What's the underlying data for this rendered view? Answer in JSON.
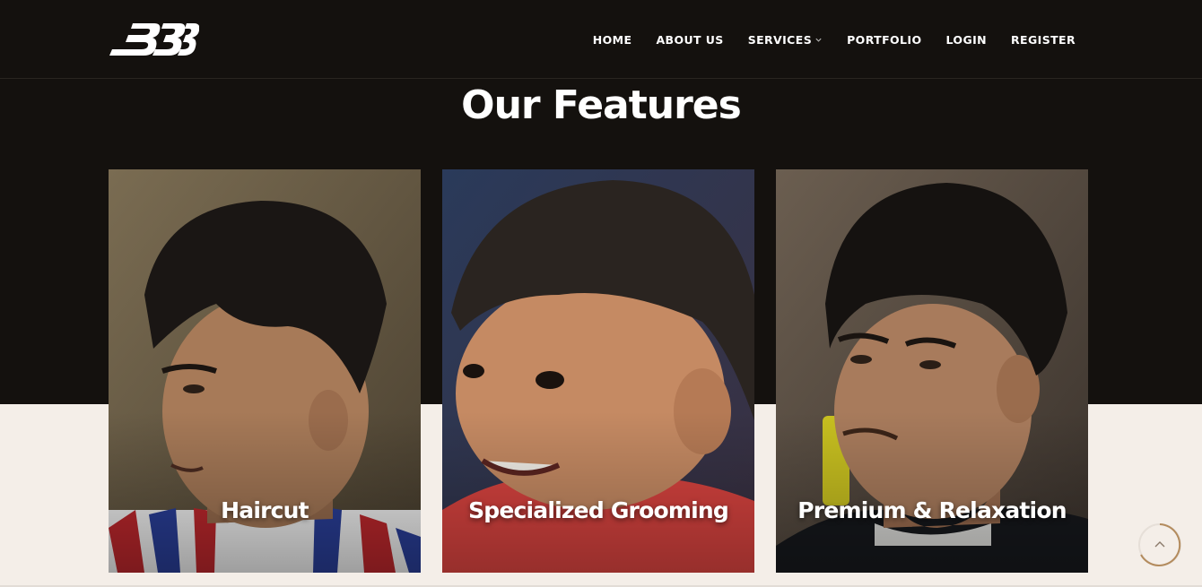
{
  "header": {
    "logo_alt": "333",
    "nav": [
      {
        "label": "HOME"
      },
      {
        "label": "ABOUT US"
      },
      {
        "label": "SERVICES",
        "has_dropdown": true
      },
      {
        "label": "PORTFOLIO"
      },
      {
        "label": "LOGIN"
      },
      {
        "label": "REGISTER"
      }
    ]
  },
  "section": {
    "title": "Our Features"
  },
  "features": [
    {
      "title": "Haircut"
    },
    {
      "title": "Specialized Grooming"
    },
    {
      "title": "Premium & Relaxation"
    }
  ],
  "colors": {
    "dark_bg": "#14110e",
    "light_bg": "#f4eee8",
    "accent": "#b38b5d",
    "text": "#ffffff"
  },
  "icons": [
    "chevron-down-icon",
    "arrow-up-icon"
  ]
}
